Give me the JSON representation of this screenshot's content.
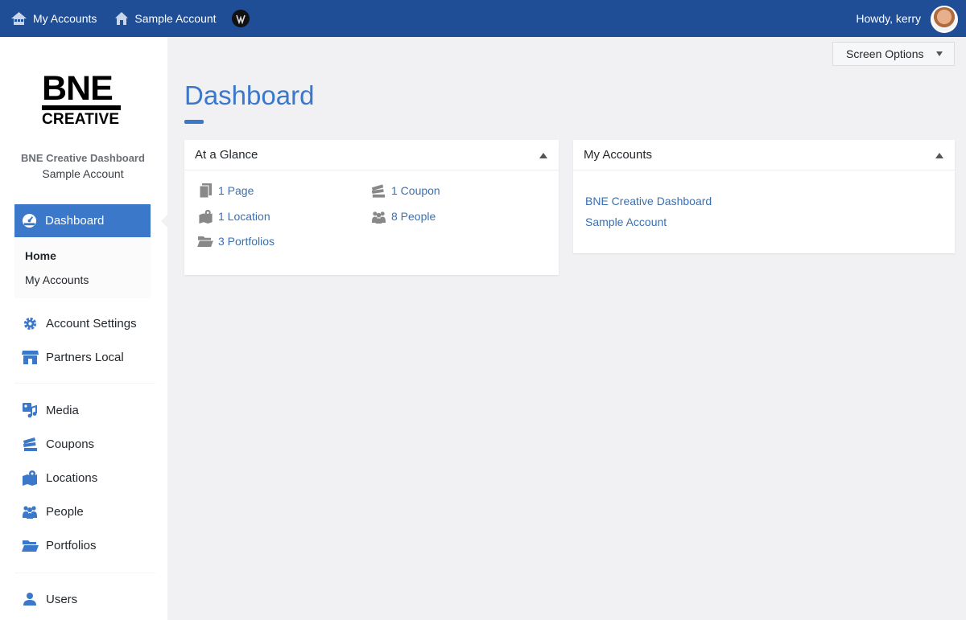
{
  "topbar": {
    "my_accounts": "My Accounts",
    "site_name": "Sample Account",
    "greeting": "Howdy, kerry"
  },
  "sidebar": {
    "logo": {
      "line1": "BNE",
      "line2": "CREATIVE"
    },
    "site_title": "BNE Creative Dashboard",
    "site_subtitle": "Sample Account",
    "current": "Dashboard",
    "submenu": [
      "Home",
      "My Accounts"
    ],
    "items": [
      "Account Settings",
      "Partners Local",
      "Media",
      "Coupons",
      "Locations",
      "People",
      "Portfolios",
      "Users"
    ]
  },
  "screen_options": "Screen Options",
  "page_title": "Dashboard",
  "glance": {
    "title": "At a Glance",
    "items": [
      "1 Page",
      "1 Coupon",
      "1 Location",
      "8 People",
      "3 Portfolios"
    ]
  },
  "accounts": {
    "title": "My Accounts",
    "links": [
      "BNE Creative Dashboard",
      "Sample Account"
    ]
  },
  "colors": {
    "topbar": "#1f4d96",
    "accent": "#3b78c9",
    "link": "#3b6fb0",
    "background": "#f1f1f4"
  }
}
